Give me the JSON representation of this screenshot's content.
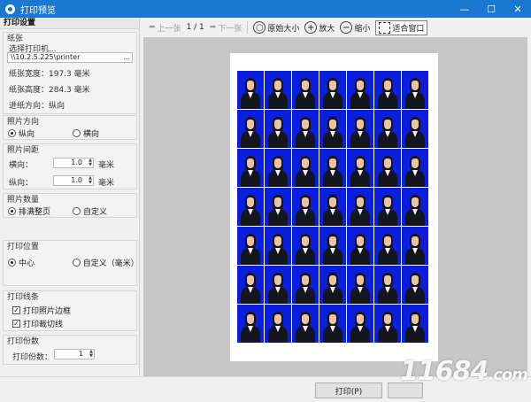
{
  "window": {
    "title": "打印预览",
    "minimize": "—",
    "maximize": "☐",
    "close": "✕"
  },
  "panel": {
    "header": "打印设置"
  },
  "paper": {
    "group_title": "纸张",
    "choose_printer": "选择打印机...",
    "printer_path": "\\\\10.2.5.225\\printer",
    "browse": "...",
    "width_label": "纸张宽度：197.3 毫米",
    "height_label": "纸张高度：284.3 毫米",
    "feed_label": "进纸方向：纵向"
  },
  "orientation": {
    "group_title": "照片方向",
    "portrait": "纵向",
    "landscape": "横向"
  },
  "spacing": {
    "group_title": "照片间距",
    "horizontal_label": "横向：",
    "horizontal_value": "1.0",
    "vertical_label": "纵向：",
    "vertical_value": "1.0",
    "unit": "毫米"
  },
  "quantity": {
    "group_title": "照片数量",
    "fill_page": "排满整页",
    "custom": "自定义"
  },
  "position": {
    "group_title": "打印位置",
    "center": "中心",
    "custom": "自定义（毫米）"
  },
  "lines": {
    "group_title": "打印线条",
    "photo_border": "打印照片边框",
    "cut_lines": "打印裁切线"
  },
  "copies": {
    "group_title": "打印份数",
    "label": "打印份数：",
    "value": "1"
  },
  "toolbar": {
    "prev": "上一张",
    "page": "1 / 1",
    "next": "下一张",
    "original_size": "原始大小",
    "zoom_in": "放大",
    "zoom_out": "缩小",
    "fit_window": "适合窗口"
  },
  "footer": {
    "print": "打印(P)"
  },
  "watermark": {
    "main": "11684",
    "suffix": ".com"
  }
}
